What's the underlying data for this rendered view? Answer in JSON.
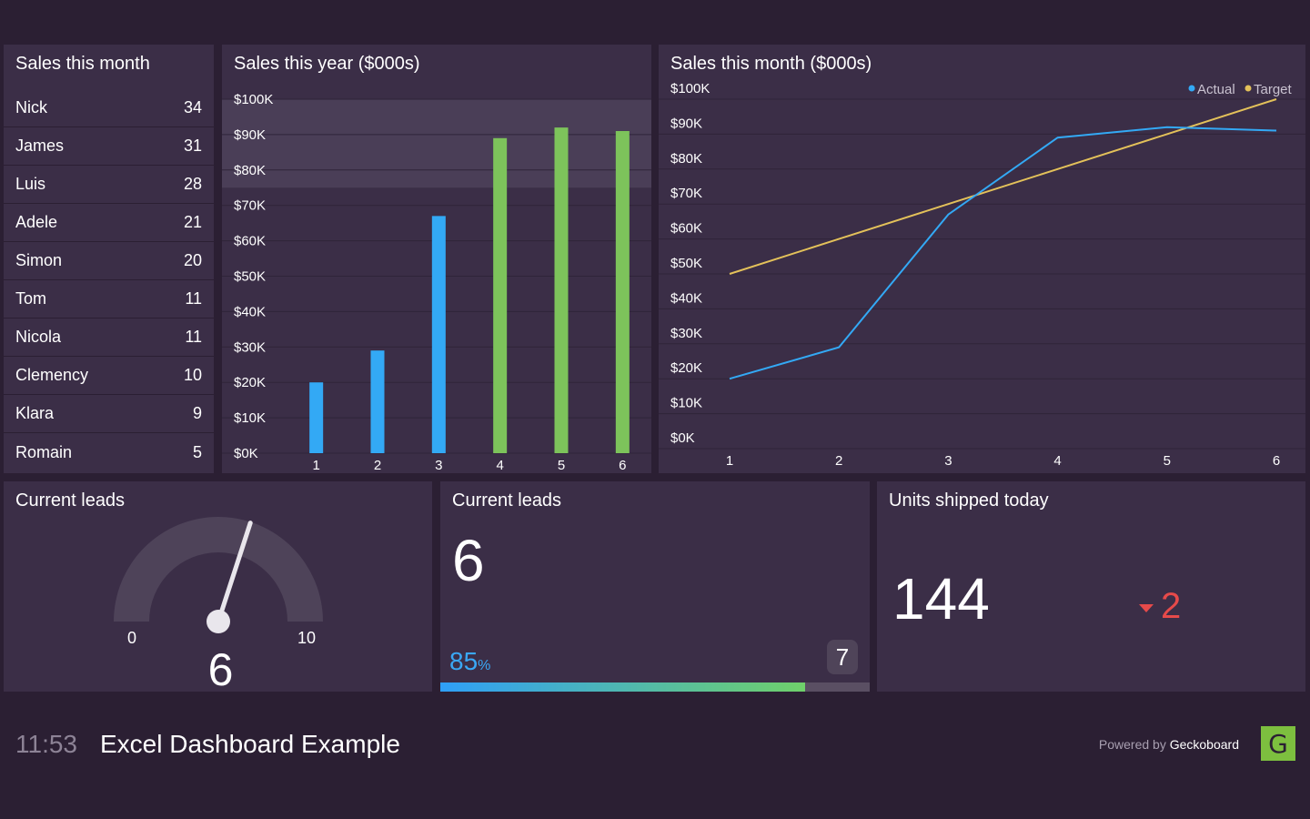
{
  "leaderboard": {
    "title": "Sales this month",
    "rows": [
      {
        "name": "Nick",
        "value": "34"
      },
      {
        "name": "James",
        "value": "31"
      },
      {
        "name": "Luis",
        "value": "28"
      },
      {
        "name": "Adele",
        "value": "21"
      },
      {
        "name": "Simon",
        "value": "20"
      },
      {
        "name": "Tom",
        "value": "11"
      },
      {
        "name": "Nicola",
        "value": "11"
      },
      {
        "name": "Clemency",
        "value": "10"
      },
      {
        "name": "Klara",
        "value": "9"
      },
      {
        "name": "Romain",
        "value": "5"
      }
    ]
  },
  "chart_data": [
    {
      "type": "bar",
      "title": "Sales this year ($000s)",
      "categories": [
        "1",
        "2",
        "3",
        "4",
        "5",
        "6"
      ],
      "values": [
        20,
        29,
        67,
        89,
        92,
        91
      ],
      "bar_colors": [
        "#33a9f5",
        "#33a9f5",
        "#33a9f5",
        "#7dc35b",
        "#7dc35b",
        "#7dc35b"
      ],
      "y_ticks": [
        "$0K",
        "$10K",
        "$20K",
        "$30K",
        "$40K",
        "$50K",
        "$60K",
        "$70K",
        "$80K",
        "$90K",
        "$100K"
      ],
      "ylim": [
        0,
        100
      ],
      "target_band": [
        75,
        100
      ]
    },
    {
      "type": "line",
      "title": "Sales this month ($000s)",
      "x": [
        "1",
        "2",
        "3",
        "4",
        "5",
        "6"
      ],
      "series": [
        {
          "name": "Actual",
          "color": "#33a9f5",
          "values": [
            20,
            29,
            67,
            89,
            92,
            91
          ]
        },
        {
          "name": "Target",
          "color": "#e3c15a",
          "values": [
            50,
            60,
            70,
            80,
            90,
            100
          ]
        }
      ],
      "y_ticks": [
        "$0K",
        "$10K",
        "$20K",
        "$30K",
        "$40K",
        "$50K",
        "$60K",
        "$70K",
        "$80K",
        "$90K",
        "$100K"
      ],
      "ylim": [
        0,
        100
      ],
      "legend": "top-right"
    }
  ],
  "gauge": {
    "title": "Current leads",
    "min": "0",
    "max": "10",
    "value": "6",
    "value_num": 6,
    "max_num": 10
  },
  "leads": {
    "title": "Current leads",
    "number": "6",
    "percent": "85",
    "percent_unit": "%",
    "percent_fraction": 0.85,
    "goal": "7"
  },
  "units": {
    "title": "Units shipped today",
    "number": "144",
    "change": "2"
  },
  "footer": {
    "time": "11:53",
    "title": "Excel Dashboard Example",
    "powered_prefix": "Powered by ",
    "powered_brand": "Geckoboard",
    "logo_letter": "G"
  }
}
